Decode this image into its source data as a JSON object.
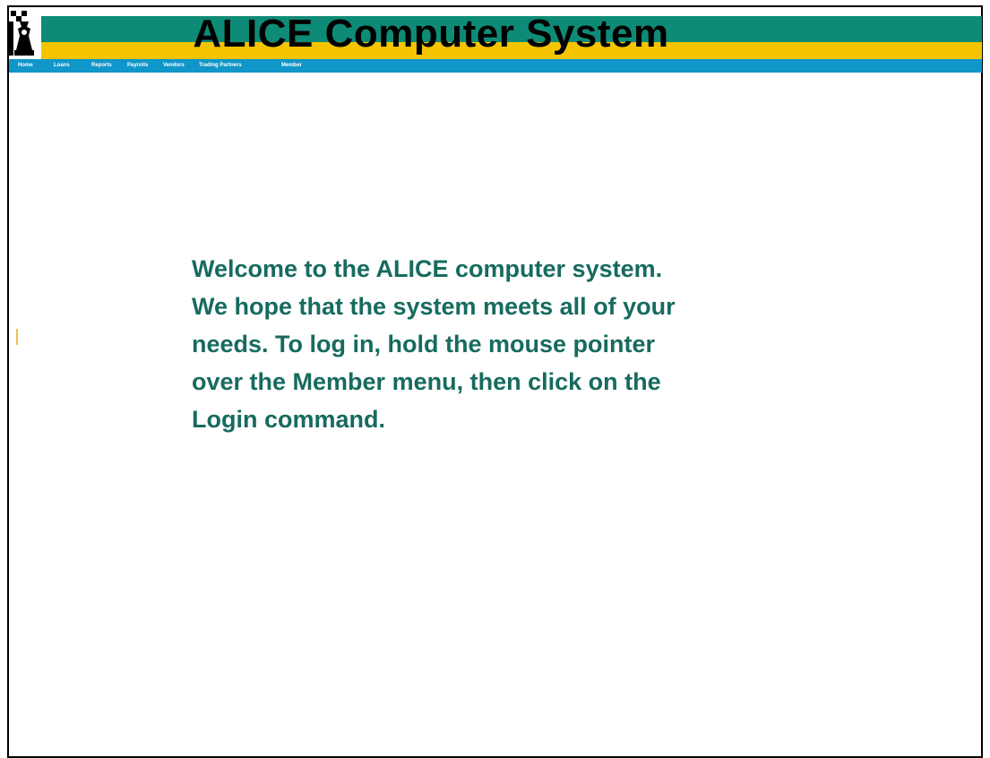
{
  "header": {
    "title": "ALICE Computer System",
    "logo_icon": "alice-chess-logo",
    "colors": {
      "teal": "#0e8b76",
      "gold": "#f5c400",
      "blue": "#1096c8"
    }
  },
  "menu": {
    "items": [
      {
        "label": "Home"
      },
      {
        "label": "Loans"
      },
      {
        "label": "Reports"
      },
      {
        "label": "Payrolls"
      },
      {
        "label": "Vendors"
      },
      {
        "label": "Trading Partners"
      },
      {
        "label": "Member"
      }
    ]
  },
  "main": {
    "welcome_text": "Welcome to the ALICE computer system.\nWe hope that the system meets all of your\nneeds.  To log in, hold the mouse pointer\nover the Member menu, then click on the\nLogin command.",
    "text_color": "#176b5e"
  }
}
